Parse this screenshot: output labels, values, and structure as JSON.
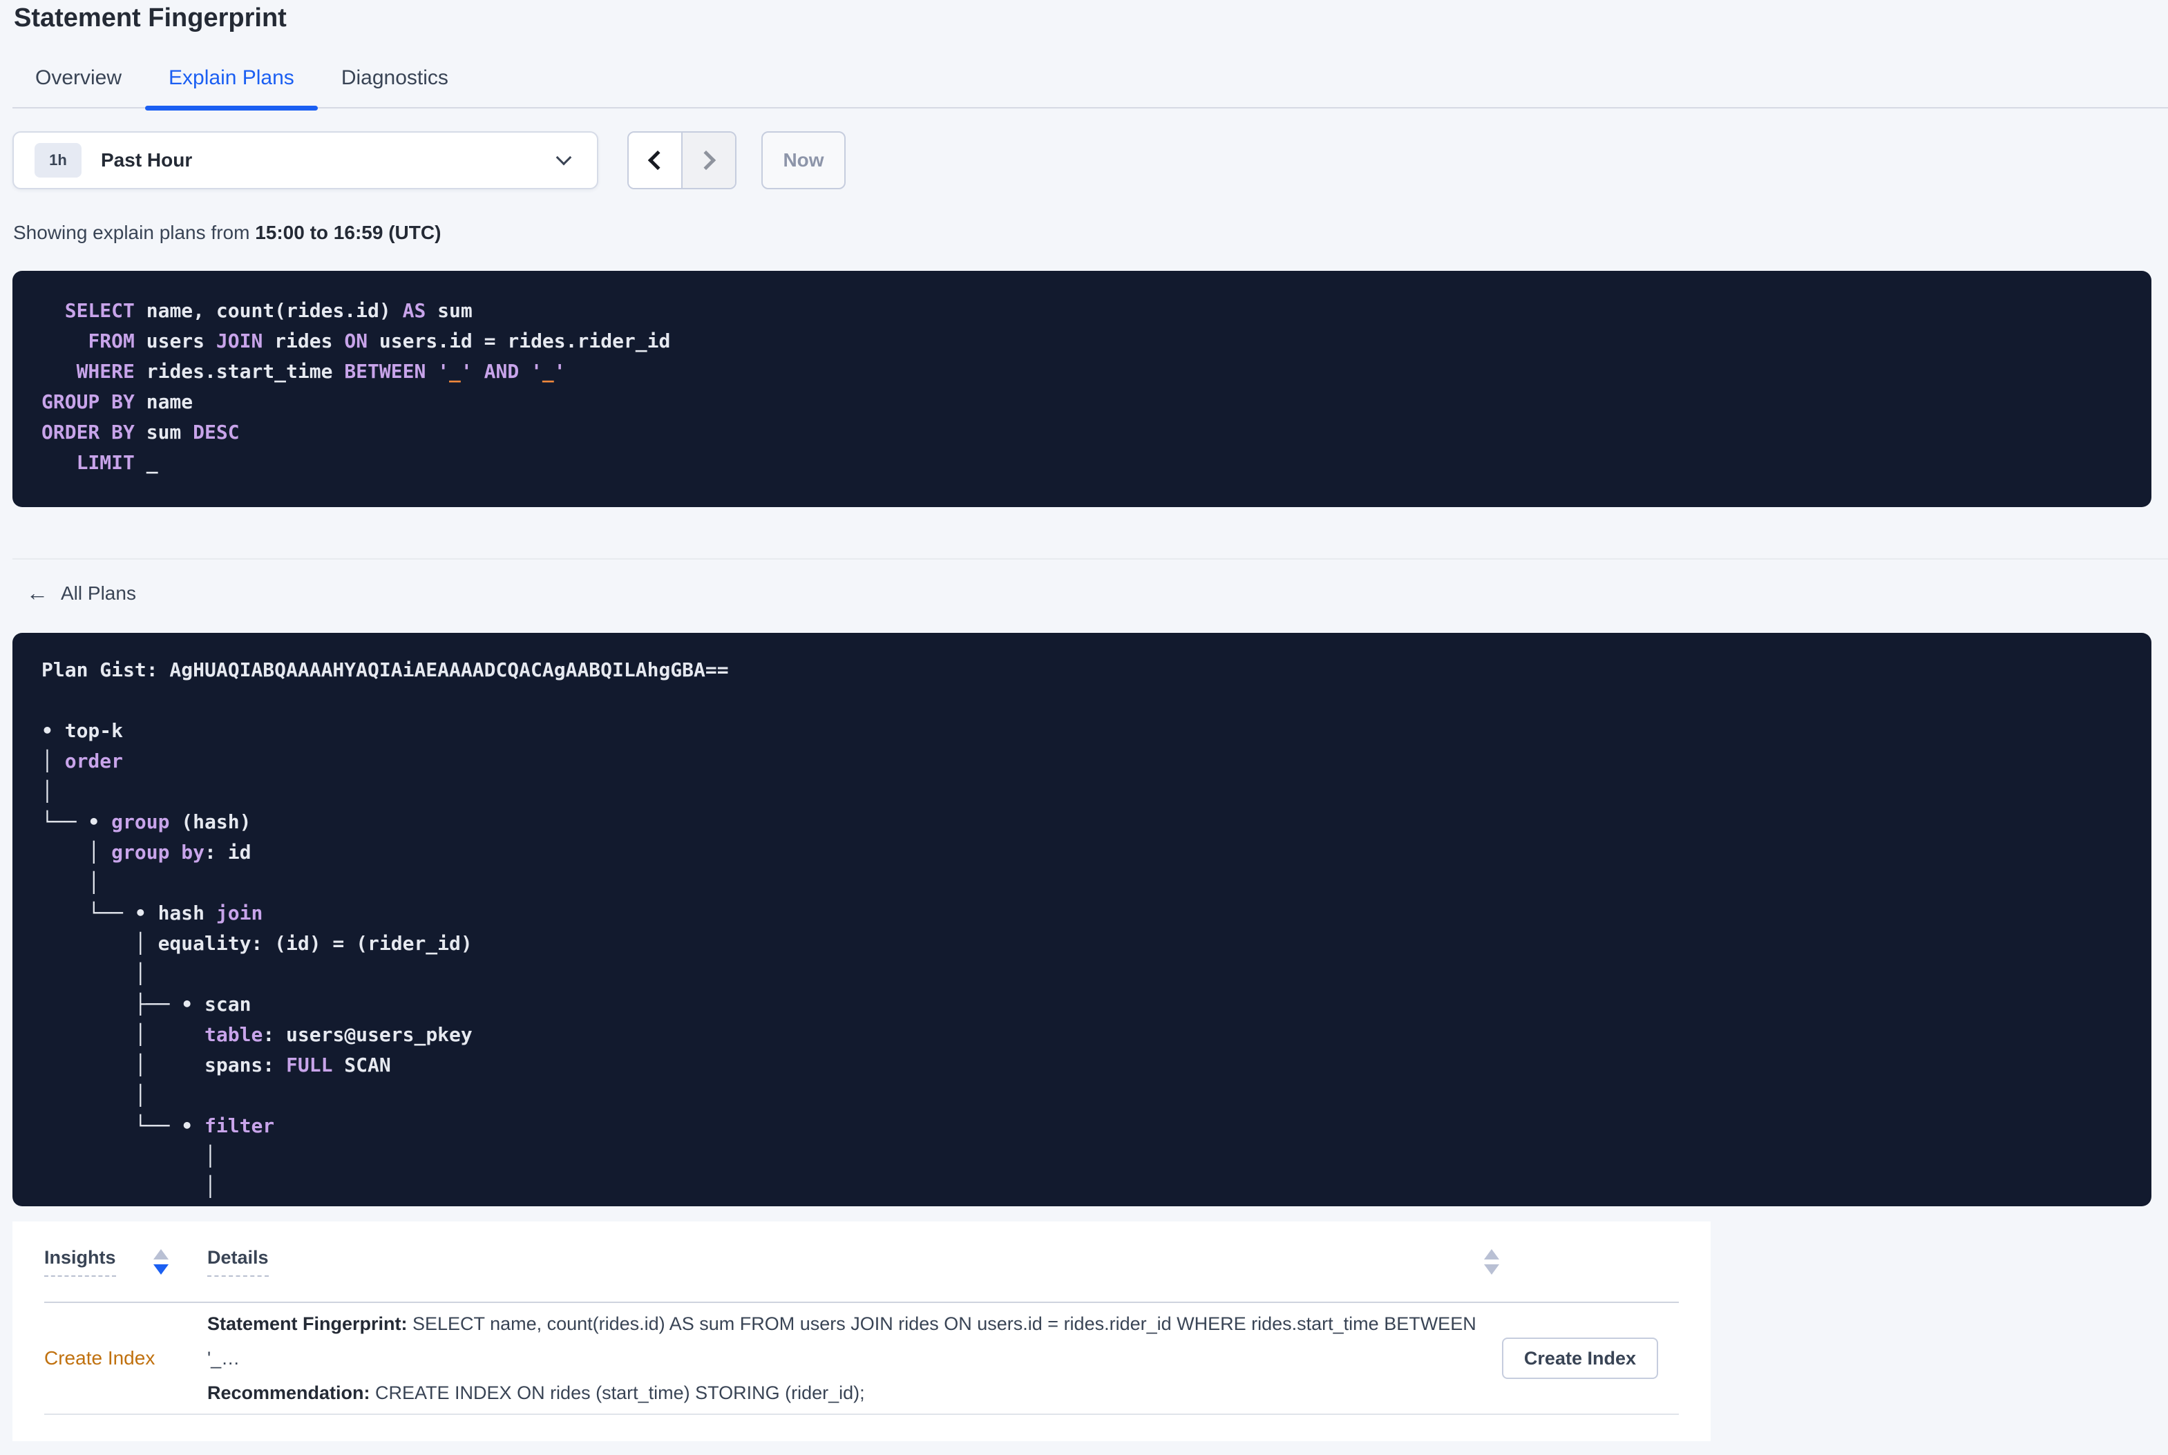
{
  "page_title": "Statement Fingerprint",
  "tabs": [
    {
      "label": "Overview"
    },
    {
      "label": "Explain Plans"
    },
    {
      "label": "Diagnostics"
    }
  ],
  "time_picker": {
    "badge": "1h",
    "label": "Past Hour",
    "now_label": "Now"
  },
  "showing": {
    "prefix": "Showing explain plans from ",
    "range": "15:00 to 16:59 (UTC)"
  },
  "sql_box": {
    "lines": [
      [
        [
          "pl",
          "  "
        ],
        [
          "kw",
          "SELECT"
        ],
        [
          "pl",
          " name, count(rides.id) "
        ],
        [
          "kw",
          "AS"
        ],
        [
          "pl",
          " sum"
        ]
      ],
      [
        [
          "pl",
          "    "
        ],
        [
          "kw",
          "FROM"
        ],
        [
          "pl",
          " users "
        ],
        [
          "kw",
          "JOIN"
        ],
        [
          "pl",
          " rides "
        ],
        [
          "kw",
          "ON"
        ],
        [
          "pl",
          " users.id = rides.rider_id"
        ]
      ],
      [
        [
          "pl",
          "   "
        ],
        [
          "kw",
          "WHERE"
        ],
        [
          "pl",
          " rides.start_time "
        ],
        [
          "kw",
          "BETWEEN"
        ],
        [
          "pl",
          " "
        ],
        [
          "kw",
          "'"
        ],
        [
          "lit",
          "_"
        ],
        [
          "kw",
          "'"
        ],
        [
          "pl",
          " "
        ],
        [
          "kw",
          "AND"
        ],
        [
          "pl",
          " "
        ],
        [
          "kw",
          "'"
        ],
        [
          "lit",
          "_"
        ],
        [
          "kw",
          "'"
        ]
      ],
      [
        [
          "kw",
          "GROUP BY"
        ],
        [
          "pl",
          " name"
        ]
      ],
      [
        [
          "kw",
          "ORDER BY"
        ],
        [
          "pl",
          " sum "
        ],
        [
          "kw",
          "DESC"
        ]
      ],
      [
        [
          "pl",
          "   "
        ],
        [
          "kw",
          "LIMIT"
        ],
        [
          "pl",
          " _"
        ]
      ]
    ]
  },
  "back_link": "All Plans",
  "plan_box": {
    "lines": [
      [
        [
          "pl",
          "Plan Gist: AgHUAQIABQAAAAHYAQIAiAEAAAADCQACAgAABQILAhgGBA=="
        ]
      ],
      [],
      [
        [
          "pl",
          "• top-k"
        ]
      ],
      [
        [
          "pl",
          "│ "
        ],
        [
          "kw",
          "order"
        ]
      ],
      [
        [
          "pl",
          "│"
        ]
      ],
      [
        [
          "pl",
          "└── • "
        ],
        [
          "kw",
          "group"
        ],
        [
          "pl",
          " (hash)"
        ]
      ],
      [
        [
          "pl",
          "    │ "
        ],
        [
          "kw",
          "group by"
        ],
        [
          "pl",
          ": id"
        ]
      ],
      [
        [
          "pl",
          "    │"
        ]
      ],
      [
        [
          "pl",
          "    └── • hash "
        ],
        [
          "kw",
          "join"
        ]
      ],
      [
        [
          "pl",
          "        │ equality: (id) = (rider_id)"
        ]
      ],
      [
        [
          "pl",
          "        │"
        ]
      ],
      [
        [
          "pl",
          "        ├── • scan"
        ]
      ],
      [
        [
          "pl",
          "        │     "
        ],
        [
          "kw",
          "table"
        ],
        [
          "pl",
          ": users@users_pkey"
        ]
      ],
      [
        [
          "pl",
          "        │     spans: "
        ],
        [
          "kw",
          "FULL"
        ],
        [
          "pl",
          " SCAN"
        ]
      ],
      [
        [
          "pl",
          "        │"
        ]
      ],
      [
        [
          "pl",
          "        └── • "
        ],
        [
          "kw",
          "filter"
        ]
      ],
      [
        [
          "pl",
          "              │"
        ]
      ],
      [
        [
          "pl",
          "              │"
        ]
      ]
    ]
  },
  "insights_table": {
    "columns": {
      "insights": "Insights",
      "details": "Details"
    },
    "row": {
      "insight": "Create Index",
      "fingerprint_label": "Statement Fingerprint:",
      "fingerprint": " SELECT name, count(rides.id) AS sum FROM users JOIN rides ON users.id = rides.rider_id WHERE rides.start_time BETWEEN '_…",
      "recommendation_label": "Recommendation:",
      "recommendation": " CREATE INDEX ON rides (start_time) STORING (rider_id);",
      "action_label": "Create Index"
    }
  },
  "colors": {
    "accent_blue": "#1b5ff2",
    "insight_orange": "#c0710f",
    "code_bg": "#121a2e",
    "code_keyword": "#c8a4ea",
    "code_text": "#e6e9f0",
    "code_literal": "#f0883c"
  }
}
